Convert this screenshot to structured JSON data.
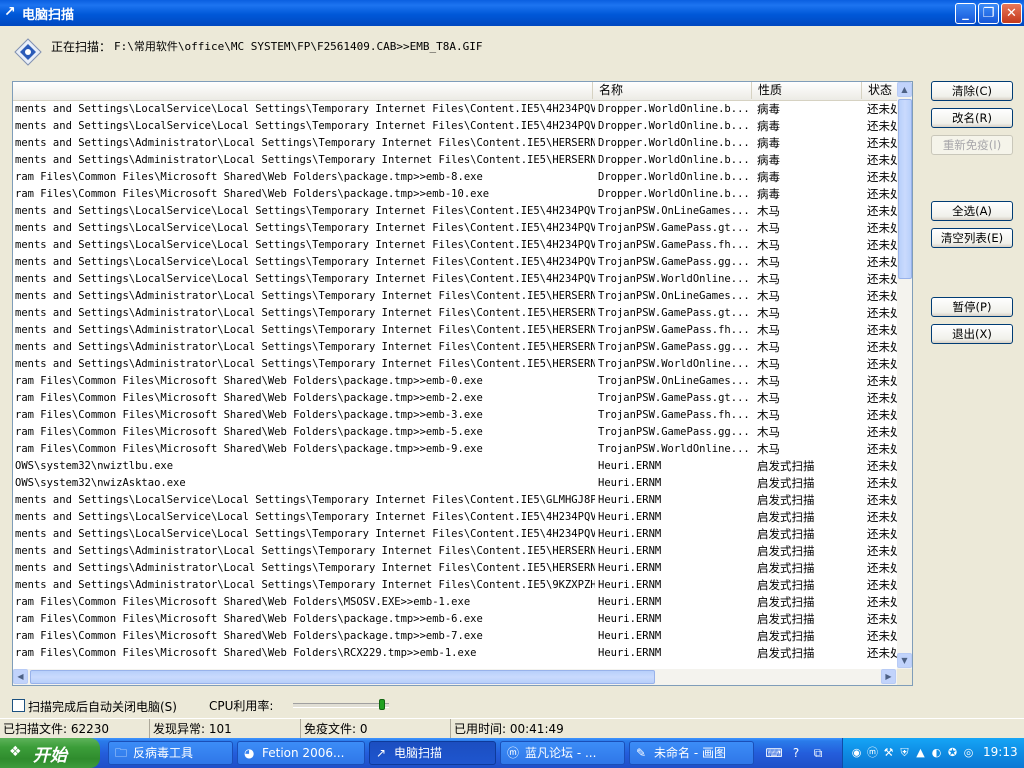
{
  "window": {
    "title": "电脑扫描",
    "minimize": "_",
    "maximize": "❐",
    "close": "✕"
  },
  "scan": {
    "label": "正在扫描：",
    "path": "F:\\常用软件\\office\\MC SYSTEM\\FP\\F2561409.CAB>>EMB_T8A.GIF"
  },
  "list": {
    "columns": [
      "",
      "名称",
      "性质",
      "状态"
    ],
    "rows": [
      [
        "ments and Settings\\LocalService\\Local Settings\\Temporary Internet Files\\Content.IE5\\4H234PQV...",
        "Dropper.WorldOnline.b...",
        "病毒",
        "还未处理"
      ],
      [
        "ments and Settings\\LocalService\\Local Settings\\Temporary Internet Files\\Content.IE5\\4H234PQV...",
        "Dropper.WorldOnline.b...",
        "病毒",
        "还未处理"
      ],
      [
        "ments and Settings\\Administrator\\Local Settings\\Temporary Internet Files\\Content.IE5\\HERSERN...",
        "Dropper.WorldOnline.b...",
        "病毒",
        "还未处理"
      ],
      [
        "ments and Settings\\Administrator\\Local Settings\\Temporary Internet Files\\Content.IE5\\HERSERN...",
        "Dropper.WorldOnline.b...",
        "病毒",
        "还未处理"
      ],
      [
        "ram Files\\Common Files\\Microsoft Shared\\Web Folders\\package.tmp>>emb-8.exe",
        "Dropper.WorldOnline.b...",
        "病毒",
        "还未处理"
      ],
      [
        "ram Files\\Common Files\\Microsoft Shared\\Web Folders\\package.tmp>>emb-10.exe",
        "Dropper.WorldOnline.b...",
        "病毒",
        "还未处理"
      ],
      [
        "ments and Settings\\LocalService\\Local Settings\\Temporary Internet Files\\Content.IE5\\4H234PQV...",
        "TrojanPSW.OnLineGames...",
        "木马",
        "还未处理"
      ],
      [
        "ments and Settings\\LocalService\\Local Settings\\Temporary Internet Files\\Content.IE5\\4H234PQV...",
        "TrojanPSW.GamePass.gt...",
        "木马",
        "还未处理"
      ],
      [
        "ments and Settings\\LocalService\\Local Settings\\Temporary Internet Files\\Content.IE5\\4H234PQV...",
        "TrojanPSW.GamePass.fh...",
        "木马",
        "还未处理"
      ],
      [
        "ments and Settings\\LocalService\\Local Settings\\Temporary Internet Files\\Content.IE5\\4H234PQV...",
        "TrojanPSW.GamePass.gg...",
        "木马",
        "还未处理"
      ],
      [
        "ments and Settings\\LocalService\\Local Settings\\Temporary Internet Files\\Content.IE5\\4H234PQV...",
        "TrojanPSW.WorldOnline...",
        "木马",
        "还未处理"
      ],
      [
        "ments and Settings\\Administrator\\Local Settings\\Temporary Internet Files\\Content.IE5\\HERSERN...",
        "TrojanPSW.OnLineGames...",
        "木马",
        "还未处理"
      ],
      [
        "ments and Settings\\Administrator\\Local Settings\\Temporary Internet Files\\Content.IE5\\HERSERN...",
        "TrojanPSW.GamePass.gt...",
        "木马",
        "还未处理"
      ],
      [
        "ments and Settings\\Administrator\\Local Settings\\Temporary Internet Files\\Content.IE5\\HERSERN...",
        "TrojanPSW.GamePass.fh...",
        "木马",
        "还未处理"
      ],
      [
        "ments and Settings\\Administrator\\Local Settings\\Temporary Internet Files\\Content.IE5\\HERSERN...",
        "TrojanPSW.GamePass.gg...",
        "木马",
        "还未处理"
      ],
      [
        "ments and Settings\\Administrator\\Local Settings\\Temporary Internet Files\\Content.IE5\\HERSERN...",
        "TrojanPSW.WorldOnline...",
        "木马",
        "还未处理"
      ],
      [
        "ram Files\\Common Files\\Microsoft Shared\\Web Folders\\package.tmp>>emb-0.exe",
        "TrojanPSW.OnLineGames...",
        "木马",
        "还未处理"
      ],
      [
        "ram Files\\Common Files\\Microsoft Shared\\Web Folders\\package.tmp>>emb-2.exe",
        "TrojanPSW.GamePass.gt...",
        "木马",
        "还未处理"
      ],
      [
        "ram Files\\Common Files\\Microsoft Shared\\Web Folders\\package.tmp>>emb-3.exe",
        "TrojanPSW.GamePass.fh...",
        "木马",
        "还未处理"
      ],
      [
        "ram Files\\Common Files\\Microsoft Shared\\Web Folders\\package.tmp>>emb-5.exe",
        "TrojanPSW.GamePass.gg...",
        "木马",
        "还未处理"
      ],
      [
        "ram Files\\Common Files\\Microsoft Shared\\Web Folders\\package.tmp>>emb-9.exe",
        "TrojanPSW.WorldOnline...",
        "木马",
        "还未处理"
      ],
      [
        "OWS\\system32\\nwiztlbu.exe",
        "Heuri.ERNM",
        "启发式扫描",
        "还未处理"
      ],
      [
        "OWS\\system32\\nwizAsktao.exe",
        "Heuri.ERNM",
        "启发式扫描",
        "还未处理"
      ],
      [
        "ments and Settings\\LocalService\\Local Settings\\Temporary Internet Files\\Content.IE5\\GLMHGJ8P...",
        "Heuri.ERNM",
        "启发式扫描",
        "还未处理"
      ],
      [
        "ments and Settings\\LocalService\\Local Settings\\Temporary Internet Files\\Content.IE5\\4H234PQV...",
        "Heuri.ERNM",
        "启发式扫描",
        "还未处理"
      ],
      [
        "ments and Settings\\LocalService\\Local Settings\\Temporary Internet Files\\Content.IE5\\4H234PQV...",
        "Heuri.ERNM",
        "启发式扫描",
        "还未处理"
      ],
      [
        "ments and Settings\\Administrator\\Local Settings\\Temporary Internet Files\\Content.IE5\\HERSERN...",
        "Heuri.ERNM",
        "启发式扫描",
        "还未处理"
      ],
      [
        "ments and Settings\\Administrator\\Local Settings\\Temporary Internet Files\\Content.IE5\\HERSERN...",
        "Heuri.ERNM",
        "启发式扫描",
        "还未处理"
      ],
      [
        "ments and Settings\\Administrator\\Local Settings\\Temporary Internet Files\\Content.IE5\\9KZXPZH...",
        "Heuri.ERNM",
        "启发式扫描",
        "还未处理"
      ],
      [
        "ram Files\\Common Files\\Microsoft Shared\\Web Folders\\MSOSV.EXE>>emb-1.exe",
        "Heuri.ERNM",
        "启发式扫描",
        "还未处理"
      ],
      [
        "ram Files\\Common Files\\Microsoft Shared\\Web Folders\\package.tmp>>emb-6.exe",
        "Heuri.ERNM",
        "启发式扫描",
        "还未处理"
      ],
      [
        "ram Files\\Common Files\\Microsoft Shared\\Web Folders\\package.tmp>>emb-7.exe",
        "Heuri.ERNM",
        "启发式扫描",
        "还未处理"
      ],
      [
        "ram Files\\Common Files\\Microsoft Shared\\Web Folders\\RCX229.tmp>>emb-1.exe",
        "Heuri.ERNM",
        "启发式扫描",
        "还未处理"
      ]
    ]
  },
  "buttons": {
    "clear": "清除(C)",
    "rename": "改名(R)",
    "reimmune": "重新免疫(I)",
    "select_all": "全选(A)",
    "clear_list": "清空列表(E)",
    "pause": "暂停(P)",
    "exit": "退出(X)"
  },
  "options": {
    "shutdown_label": "扫描完成后自动关闭电脑(S)",
    "shutdown_checked": false,
    "cpu_label": "CPU利用率:",
    "cpu_level_fraction": 0.95
  },
  "status": {
    "scanned": "已扫描文件: 62230",
    "found": "发现异常: 101",
    "immune": "免疫文件: 0",
    "elapsed": "已用时间: 00:41:49"
  },
  "taskbar": {
    "start": "开始",
    "tasks": [
      {
        "icon": "folder-icon",
        "label": "反病毒工具"
      },
      {
        "icon": "fetion-icon",
        "label": "Fetion 2006..."
      },
      {
        "icon": "scan-icon",
        "label": "电脑扫描",
        "active": true
      },
      {
        "icon": "browser-icon",
        "label": "蓝凡论坛 - ..."
      },
      {
        "icon": "paint-icon",
        "label": "未命名 - 画图"
      }
    ],
    "clock": "19:13"
  },
  "colors": {
    "titlebar": "#0A5FE0",
    "taskbar": "#245EDC",
    "start_button": "#3C9E3A",
    "tray": "#0E8CE4",
    "window_bg": "#ECE9D8"
  }
}
